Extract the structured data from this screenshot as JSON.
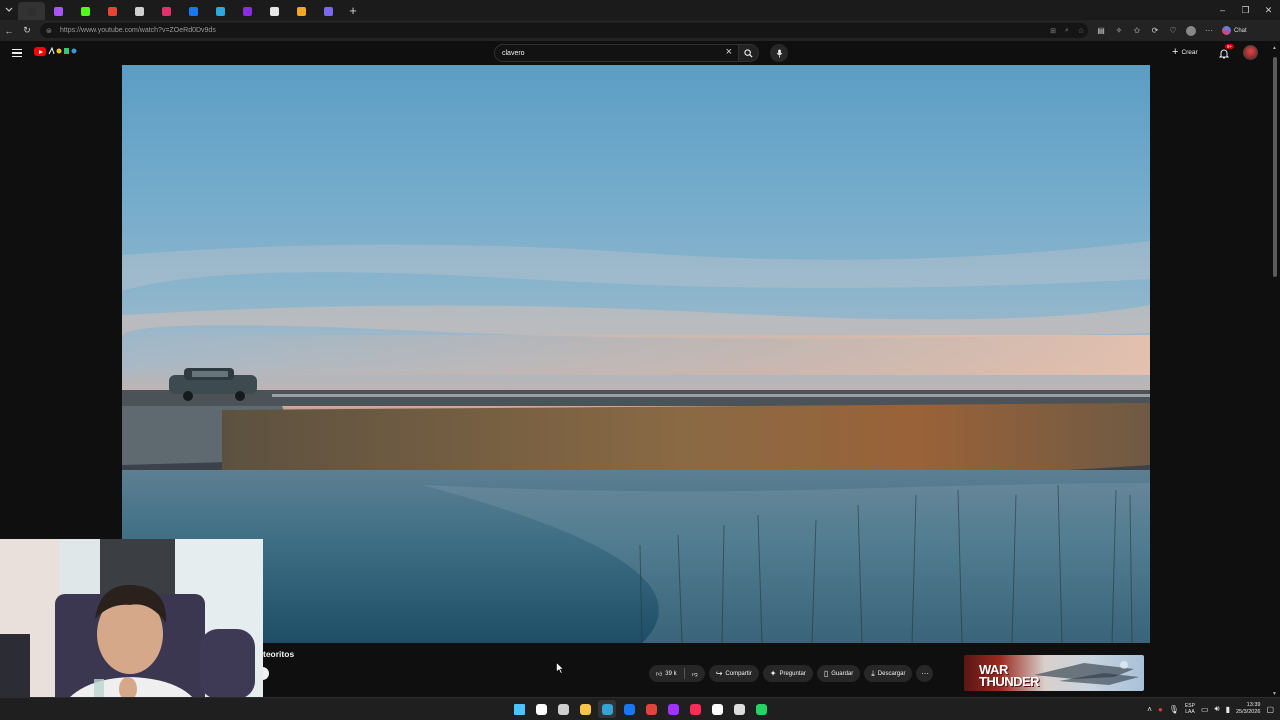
{
  "browser": {
    "tab_list_icon": "chevron-down-icon",
    "tabs": [
      {
        "icon": "speaker-icon",
        "color": "#2f2f2f",
        "active": true
      },
      {
        "icon": "app-icon",
        "color": "#a855f7"
      },
      {
        "icon": "kick-icon",
        "color": "#53fc18"
      },
      {
        "icon": "gmail-icon",
        "color": "#ea4335"
      },
      {
        "icon": "globe-icon",
        "color": "#cfcfcf"
      },
      {
        "icon": "instagram-icon",
        "color": "#e1306c"
      },
      {
        "icon": "facebook-icon",
        "color": "#1877f2"
      },
      {
        "icon": "app-icon",
        "color": "#2aa8e0"
      },
      {
        "icon": "app-icon",
        "color": "#8b2be2"
      },
      {
        "icon": "github-icon",
        "color": "#e6e6e6"
      },
      {
        "icon": "app-icon",
        "color": "#f5a623"
      },
      {
        "icon": "app-icon",
        "color": "#7b68ee"
      }
    ],
    "url": "https://www.youtube.com/watch?v=ZOeRd0Dv9ds",
    "chat_label": "Chat"
  },
  "youtube": {
    "search_query": "clavero",
    "create_label": "Crear",
    "notification_count": "9+",
    "video_title_partial": "teoritos",
    "actions": {
      "like_count": "39 k",
      "share_label": "Compartir",
      "ask_label": "Preguntar",
      "save_label": "Guardar",
      "download_label": "Descargar"
    },
    "ad_text_line1": "WAR",
    "ad_text_line2": "THUNDER"
  },
  "taskbar": {
    "apps": [
      {
        "icon": "windows-start-icon",
        "color": "#4cc2ff"
      },
      {
        "icon": "search-icon",
        "color": "#ffffff"
      },
      {
        "icon": "task-view-icon",
        "color": "#cfcfcf"
      },
      {
        "icon": "file-explorer-icon",
        "color": "#f7c548"
      },
      {
        "icon": "edge-icon",
        "color": "#34a3d6",
        "active": true
      },
      {
        "icon": "facebook-icon",
        "color": "#1877f2"
      },
      {
        "icon": "chrome-icon",
        "color": "#e0443a"
      },
      {
        "icon": "messenger-icon",
        "color": "#a033ff"
      },
      {
        "icon": "tiktok-icon",
        "color": "#ff2d55"
      },
      {
        "icon": "capcut-icon",
        "color": "#ffffff"
      },
      {
        "icon": "app-icon",
        "color": "#dddddd"
      },
      {
        "icon": "whatsapp-icon",
        "color": "#25d366"
      }
    ],
    "language_top": "ESP",
    "language_bottom": "LAA",
    "time": "13:39",
    "date": "25/3/2026"
  }
}
